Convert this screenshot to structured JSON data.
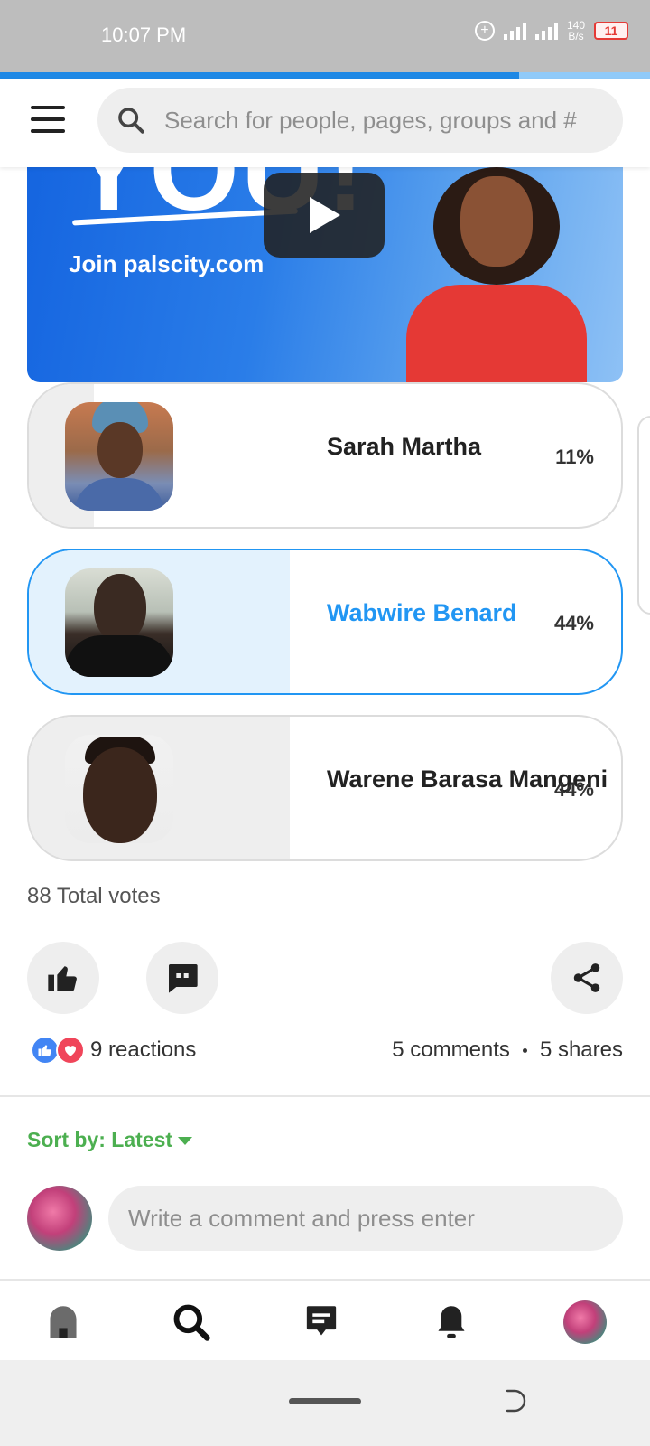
{
  "status_bar": {
    "time": "10:07 PM",
    "net_speed": "140",
    "net_unit": "B/s",
    "battery": "11",
    "network_type": "4G"
  },
  "search": {
    "placeholder": "Search for people, pages, groups and #"
  },
  "banner": {
    "headline": "YOU!",
    "cta": "Join palscity.com"
  },
  "poll": {
    "options": [
      {
        "name": "Sarah Martha",
        "percent_label": "11%",
        "percent": 11,
        "selected": false
      },
      {
        "name": "Wabwire Benard",
        "percent_label": "44%",
        "percent": 44,
        "selected": true
      },
      {
        "name": "Warene Barasa Mangeni",
        "percent_label": "44%",
        "percent": 44,
        "selected": false
      }
    ],
    "total_votes": "88 Total votes"
  },
  "actions": {
    "like_icon": "thumbs-up-icon",
    "comment_icon": "comment-icon",
    "share_icon": "share-icon"
  },
  "engagement": {
    "reactions": "9 reactions",
    "comments": "5 comments",
    "shares": "5 shares"
  },
  "comments_section": {
    "sort_prefix": "Sort by: ",
    "sort_value": "Latest",
    "input_placeholder": "Write a comment and press enter"
  },
  "bottom_nav": {
    "items": [
      "home-icon",
      "search-icon",
      "messages-icon",
      "notifications-icon",
      "profile-avatar"
    ]
  },
  "colors": {
    "accent_blue": "#2196f3",
    "accent_green": "#4caf50",
    "love_red": "#f0455a",
    "like_blue": "#4285f4"
  }
}
